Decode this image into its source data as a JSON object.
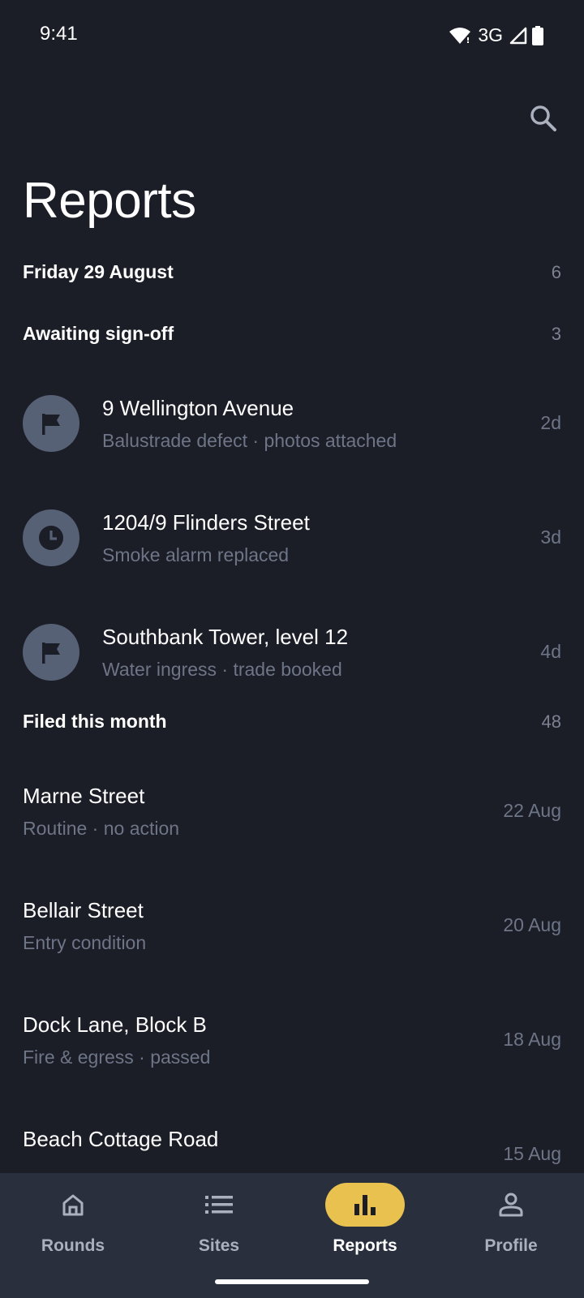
{
  "status": {
    "time": "9:41",
    "network": "3G"
  },
  "header": {
    "title": "Reports",
    "search_icon": "search-icon"
  },
  "sections": {
    "date": {
      "label": "Friday 29 August",
      "count": "6"
    },
    "awaiting": {
      "label": "Awaiting sign-off",
      "count": "3"
    },
    "filed": {
      "label": "Filed this month",
      "count": "48"
    }
  },
  "awaiting_items": [
    {
      "title": "9 Wellington Avenue",
      "subtitle": "Balustrade defect · photos attached",
      "age": "2d",
      "icon": "flag-icon"
    },
    {
      "title": "1204/9 Flinders Street",
      "subtitle": "Smoke alarm replaced",
      "age": "3d",
      "icon": "clock-icon"
    },
    {
      "title": "Southbank Tower, level 12",
      "subtitle": "Water ingress · trade booked",
      "age": "4d",
      "icon": "flag-icon"
    }
  ],
  "filed_items": [
    {
      "title": "Marne Street",
      "subtitle": "Routine · no action",
      "date": "22 Aug"
    },
    {
      "title": "Bellair Street",
      "subtitle": "Entry condition",
      "date": "20 Aug"
    },
    {
      "title": "Dock Lane, Block B",
      "subtitle": "Fire & egress · passed",
      "date": "18 Aug"
    },
    {
      "title": "Beach Cottage Road",
      "subtitle": "",
      "date": "15 Aug"
    }
  ],
  "nav": [
    {
      "label": "Rounds",
      "icon": "home-icon",
      "active": false
    },
    {
      "label": "Sites",
      "icon": "list-icon",
      "active": false
    },
    {
      "label": "Reports",
      "icon": "bar-chart-icon",
      "active": true
    },
    {
      "label": "Profile",
      "icon": "person-icon",
      "active": false
    }
  ],
  "colors": {
    "background": "#1b1d27",
    "accent": "#e8c14e",
    "nav_background": "#2a2f3e",
    "avatar": "#566175"
  }
}
